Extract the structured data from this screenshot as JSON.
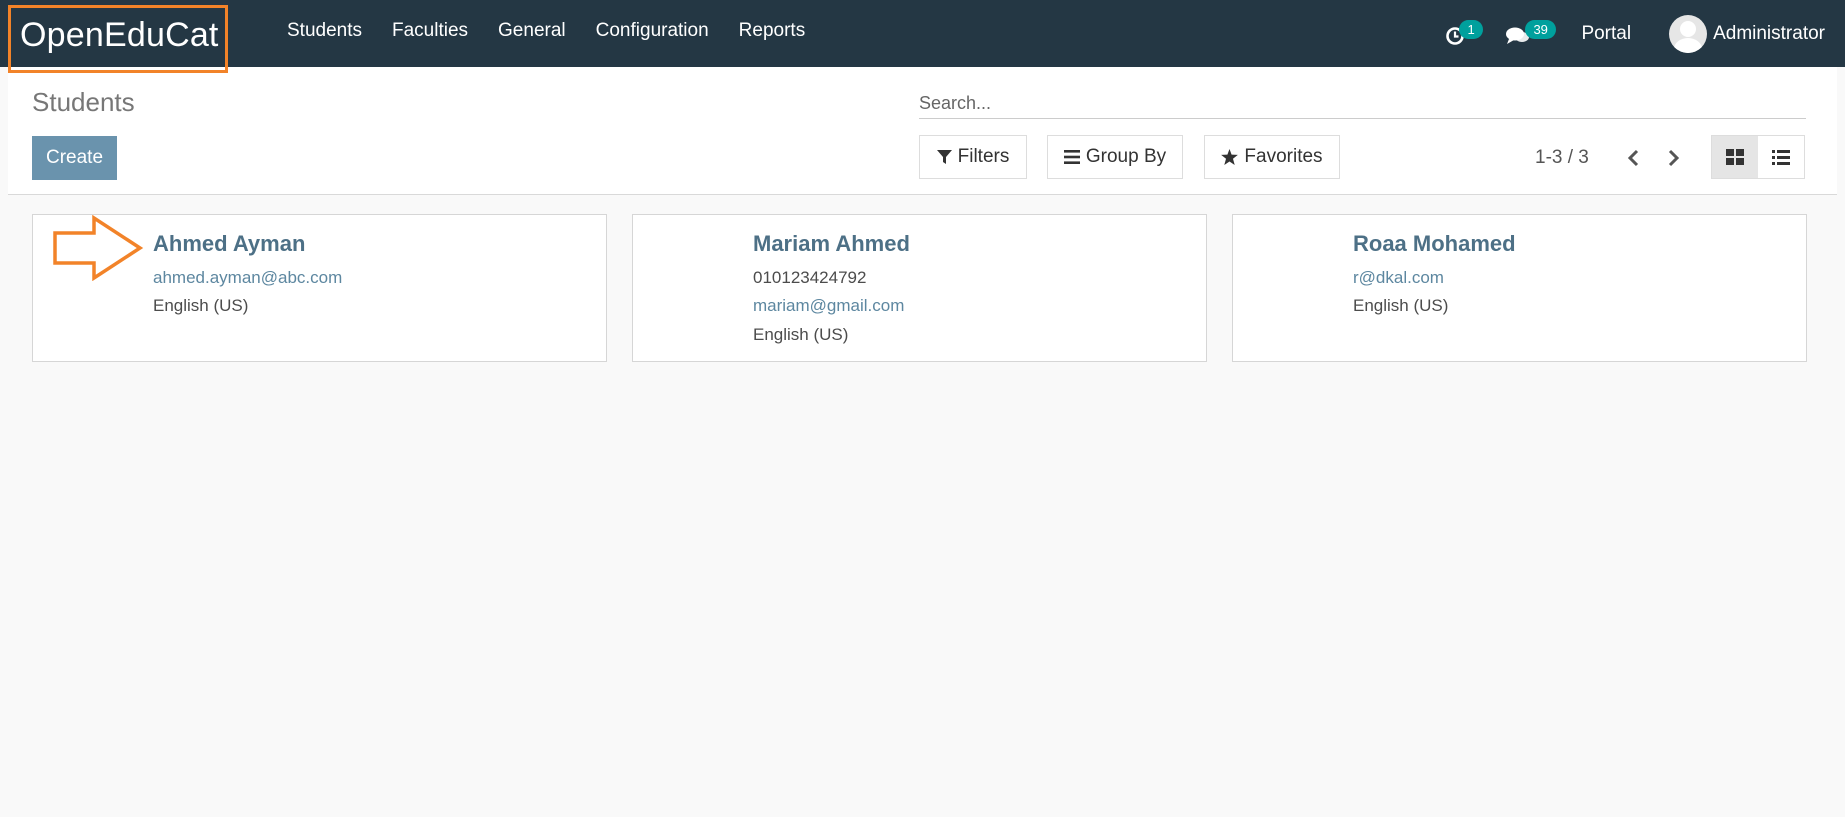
{
  "app": {
    "brand": "OpenEduCat"
  },
  "menu": {
    "items": [
      "Students",
      "Faculties",
      "General",
      "Configuration",
      "Reports"
    ]
  },
  "systray": {
    "activity_count": "1",
    "messages_count": "39",
    "portal_label": "Portal",
    "user_name": "Administrator"
  },
  "control_panel": {
    "title": "Students",
    "create_label": "Create",
    "search_placeholder": "Search...",
    "filters_label": "Filters",
    "group_by_label": "Group By",
    "favorites_label": "Favorites",
    "pager": "1-3 / 3",
    "active_view": "kanban"
  },
  "records": [
    {
      "name": "Ahmed Ayman",
      "email": "ahmed.ayman@abc.com",
      "language": "English (US)"
    },
    {
      "name": "Mariam Ahmed",
      "phone": "010123424792",
      "email": "mariam@gmail.com",
      "language": "English (US)"
    },
    {
      "name": "Roaa Mohamed",
      "email": "r@dkal.com",
      "language": "English (US)"
    }
  ],
  "colors": {
    "navbar": "#243744",
    "primary_button": "#6a93ad",
    "record_name": "#4d7086",
    "badge": "#00a09d",
    "highlight": "#f28329"
  }
}
